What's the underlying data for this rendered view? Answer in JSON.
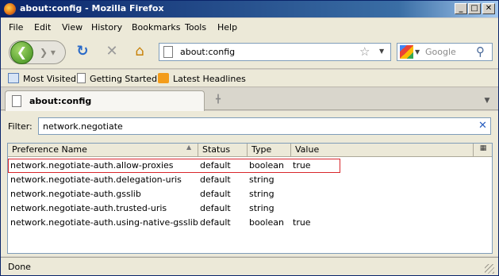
{
  "window": {
    "title": "about:config - Mozilla Firefox",
    "controls": [
      "_",
      "□",
      "✕"
    ]
  },
  "menubar": {
    "items": [
      "File",
      "Edit",
      "View",
      "History",
      "Bookmarks",
      "Tools",
      "Help"
    ]
  },
  "navbar": {
    "url": "about:config",
    "search_placeholder": "Google"
  },
  "bookmarks": {
    "items": [
      "Most Visited",
      "Getting Started",
      "Latest Headlines"
    ]
  },
  "tabs": [
    {
      "label": "about:config"
    }
  ],
  "filter": {
    "label": "Filter:",
    "value": "network.negotiate"
  },
  "table": {
    "columns": [
      "Preference Name",
      "Status",
      "Type",
      "Value"
    ],
    "rows": [
      {
        "name": "network.negotiate-auth.allow-proxies",
        "status": "default",
        "type": "boolean",
        "value": "true"
      },
      {
        "name": "network.negotiate-auth.delegation-uris",
        "status": "default",
        "type": "string",
        "value": ""
      },
      {
        "name": "network.negotiate-auth.gsslib",
        "status": "default",
        "type": "string",
        "value": ""
      },
      {
        "name": "network.negotiate-auth.trusted-uris",
        "status": "default",
        "type": "string",
        "value": ""
      },
      {
        "name": "network.negotiate-auth.using-native-gsslib",
        "status": "default",
        "type": "boolean",
        "value": "true"
      }
    ]
  },
  "status": {
    "text": "Done"
  },
  "colors": {
    "titlebar": "#0a246a",
    "highlight_border": "#d8262c",
    "chrome": "#ece9d8"
  }
}
